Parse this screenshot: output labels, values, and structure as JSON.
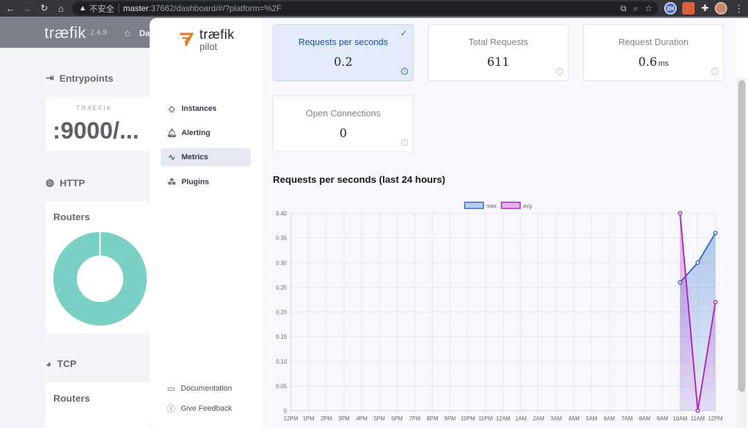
{
  "browser": {
    "warning": "不安全",
    "url_host": "master",
    "url_rest": ":37662/dashboard/#/?platform=%2F",
    "ext_badge": "2H"
  },
  "dashboard": {
    "logo": "træfik",
    "version": "2.4.9",
    "home_label": "Da",
    "entrypoints_title": "Entrypoints",
    "entrypoint_name": "TRAEFIK",
    "entrypoint_value": ":9000/...",
    "http_title": "HTTP",
    "tcp_title": "TCP",
    "routers_label": "Routers",
    "routers_label_2": "Routers"
  },
  "pilot": {
    "logo_title": "træfik",
    "logo_subtitle": "pilot",
    "nav": [
      {
        "label": "Instances",
        "icon": "diamond-icon"
      },
      {
        "label": "Alerting",
        "icon": "bell-icon"
      },
      {
        "label": "Metrics",
        "icon": "pulse-icon",
        "active": true
      },
      {
        "label": "Plugins",
        "icon": "cubes-icon"
      }
    ],
    "footer": {
      "documentation": "Documentation",
      "feedback": "Give Feedback"
    }
  },
  "metrics": {
    "cards": [
      {
        "label": "Requests per seconds",
        "value": "0.2",
        "unit": "",
        "selected": true
      },
      {
        "label": "Total Requests",
        "value": "611",
        "unit": ""
      },
      {
        "label": "Request Duration",
        "value": "0.6",
        "unit": "ms"
      },
      {
        "label": "Open Connections",
        "value": "0",
        "unit": ""
      }
    ],
    "chart_title": "Requests per seconds (last 24 hours)"
  },
  "colors": {
    "max_line": "#2b6bd1",
    "avg_line": "#b51fc7",
    "donut": "#79d1c5",
    "selected_card": "#e3ebfb"
  },
  "chart_data": {
    "type": "area",
    "title": "Requests per seconds (last 24 hours)",
    "xlabel": "",
    "ylabel": "",
    "x": [
      "12PM",
      "1PM",
      "2PM",
      "3PM",
      "4PM",
      "5PM",
      "6PM",
      "7PM",
      "8PM",
      "9PM",
      "10PM",
      "11PM",
      "12AM",
      "1AM",
      "2AM",
      "3AM",
      "4AM",
      "5AM",
      "6AM",
      "7AM",
      "8AM",
      "9AM",
      "10AM",
      "11AM",
      "12PM"
    ],
    "ylim": [
      0,
      0.4
    ],
    "yticks": [
      "0.40",
      "0.35",
      "0.30",
      "0.25",
      "0.20",
      "0.15",
      "0.10",
      "0.05",
      "0"
    ],
    "legend_position": "top-center",
    "grid": true,
    "series": [
      {
        "name": "max",
        "color": "#2b6bd1",
        "x": [
          "10AM",
          "11AM",
          "12PM"
        ],
        "values": [
          0.26,
          0.3,
          0.36
        ]
      },
      {
        "name": "avg",
        "color": "#b51fc7",
        "x": [
          "10AM",
          "11AM",
          "12PM"
        ],
        "values": [
          0.4,
          0.0,
          0.22
        ]
      }
    ]
  }
}
